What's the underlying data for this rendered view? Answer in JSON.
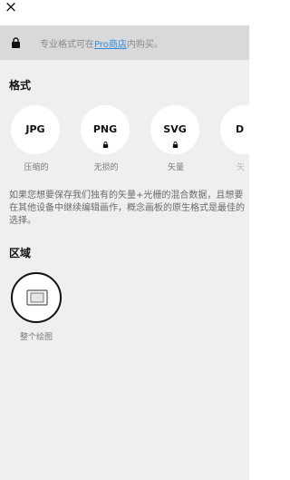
{
  "close_label": "×",
  "pro_banner": {
    "text_before": "专业格式可在",
    "link": "Pro商店",
    "text_after": "内购买。"
  },
  "format_section": {
    "title": "格式",
    "items": [
      {
        "name": "JPG",
        "caption": "压缩的",
        "locked": false
      },
      {
        "name": "PNG",
        "caption": "无损的",
        "locked": true
      },
      {
        "name": "SVG",
        "caption": "矢量",
        "locked": true
      },
      {
        "name": "D",
        "caption": "矢",
        "locked": false
      }
    ],
    "description": "如果您想要保存我们独有的矢量+光栅的混合数据，且想要在其他设备中继续编辑画作，概念画板的原生格式是最佳的选择。"
  },
  "region_section": {
    "title": "区域",
    "items": [
      {
        "caption": "整个绘图",
        "selected": true
      }
    ]
  },
  "colors": {
    "panel_bg": "#efeff1",
    "banner_bg": "#d9d9dc",
    "link": "#2f8fd8"
  }
}
